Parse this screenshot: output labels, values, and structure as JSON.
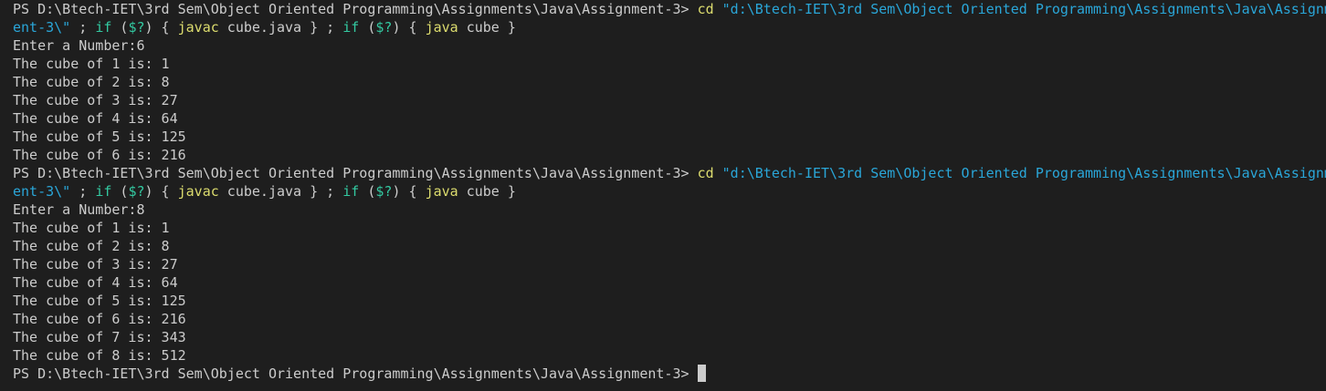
{
  "terminal": {
    "prompt": "PS D:\\Btech-IET\\3rd Sem\\Object Oriented Programming\\Assignments\\Java\\Assignment-3> ",
    "cmd_cd": "cd",
    "cmd_path_part1": " \"d:\\Btech-IET\\3rd Sem\\Object Oriented Programming\\Assignments\\Java\\Assignm",
    "cmd_path_part2": "ent-3\\\"",
    "sep1": " ; ",
    "if1": "if",
    "sp1": " (",
    "cond1": "$?",
    "close1": ") { ",
    "javac": "javac",
    "javac_arg": " cube.java } ; ",
    "if2": "if",
    "sp2": " (",
    "cond2": "$?",
    "close2": ") { ",
    "java": "java",
    "java_arg": " cube }",
    "run1": {
      "enter": "Enter a Number:6",
      "results": [
        "The cube of 1 is: 1",
        "The cube of 2 is: 8",
        "The cube of 3 is: 27",
        "The cube of 4 is: 64",
        "The cube of 5 is: 125",
        "The cube of 6 is: 216"
      ]
    },
    "run2": {
      "enter": "Enter a Number:8",
      "results": [
        "The cube of 1 is: 1",
        "The cube of 2 is: 8",
        "The cube of 3 is: 27",
        "The cube of 4 is: 64",
        "The cube of 5 is: 125",
        "The cube of 6 is: 216",
        "The cube of 7 is: 343",
        "The cube of 8 is: 512"
      ]
    },
    "colors": {
      "background": "#1e1e1e",
      "text": "#cccccc",
      "command": "#dcdc6e",
      "string": "#2aa6d8",
      "variable": "#33c9a1"
    }
  }
}
